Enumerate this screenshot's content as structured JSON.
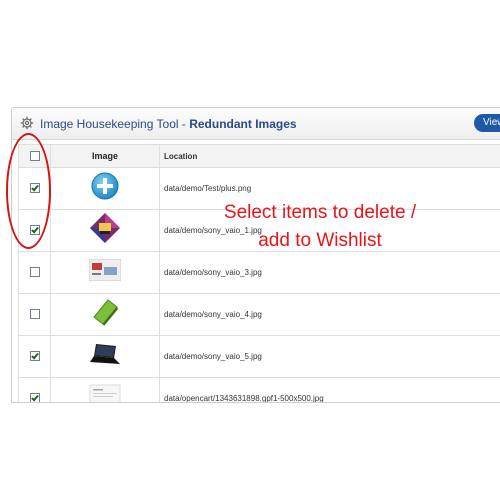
{
  "panel": {
    "title_prefix": "Image Housekeeping Tool - ",
    "title_bold": "Redundant Images",
    "view_button": "View"
  },
  "table": {
    "headers": {
      "image": "Image",
      "location": "Location"
    },
    "rows": [
      {
        "checked": true,
        "icon": "plus-circle-icon",
        "location": "data/demo/Test/plus.png"
      },
      {
        "checked": true,
        "icon": "sony-vaio-collage-thumbnail",
        "location": "data/demo/sony_vaio_1.jpg"
      },
      {
        "checked": false,
        "icon": "sony-vaio-banner-thumbnail",
        "location": "data/demo/sony_vaio_3.jpg"
      },
      {
        "checked": false,
        "icon": "green-laptop-thumbnail",
        "location": "data/demo/sony_vaio_4.jpg"
      },
      {
        "checked": true,
        "icon": "black-laptop-thumbnail",
        "location": "data/demo/sony_vaio_5.jpg"
      },
      {
        "checked": true,
        "icon": "document-thumbnail",
        "location": "data/opencart/1343631898.gpf1-500x500.jpg"
      }
    ]
  },
  "callout": {
    "line1": "Select items to delete /",
    "line2": "add to Wishlist"
  },
  "colors": {
    "accent": "#1e58a8",
    "title": "#2a4a88",
    "callout": "#e8141c"
  }
}
